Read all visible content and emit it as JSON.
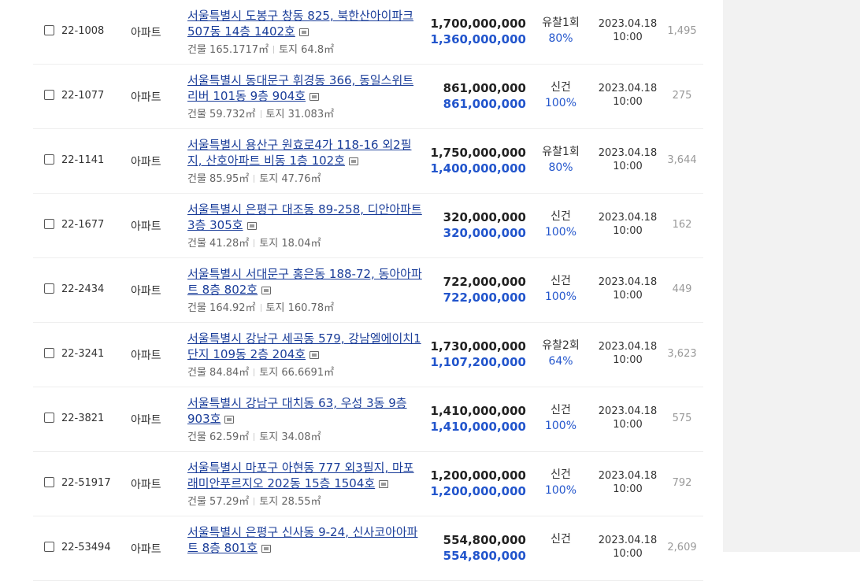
{
  "rows": [
    {
      "case": "22-1008",
      "kind": "아파트",
      "addr": "서울특별시 도봉구 창동 825, 북한산아이파크 507동 14층 1402호",
      "building": "건물 165.1717㎡",
      "land": "토지 64.8㎡",
      "appraised": "1,700,000,000",
      "minimum": "1,360,000,000",
      "status": "유찰1회",
      "percent": "80%",
      "date": "2023.04.18",
      "time": "10:00",
      "views": "1,495"
    },
    {
      "case": "22-1077",
      "kind": "아파트",
      "addr": "서울특별시 동대문구 휘경동 366, 동일스위트리버 101동 9층 904호",
      "building": "건물 59.732㎡",
      "land": "토지 31.083㎡",
      "appraised": "861,000,000",
      "minimum": "861,000,000",
      "status": "신건",
      "percent": "100%",
      "date": "2023.04.18",
      "time": "10:00",
      "views": "275"
    },
    {
      "case": "22-1141",
      "kind": "아파트",
      "addr": "서울특별시 용산구 원효로4가 118-16 외2필지, 산호아파트 비동 1층 102호",
      "building": "건물 85.95㎡",
      "land": "토지 47.76㎡",
      "appraised": "1,750,000,000",
      "minimum": "1,400,000,000",
      "status": "유찰1회",
      "percent": "80%",
      "date": "2023.04.18",
      "time": "10:00",
      "views": "3,644"
    },
    {
      "case": "22-1677",
      "kind": "아파트",
      "addr": "서울특별시 은평구 대조동 89-258, 디안아파트 3층 305호",
      "building": "건물 41.28㎡",
      "land": "토지 18.04㎡",
      "appraised": "320,000,000",
      "minimum": "320,000,000",
      "status": "신건",
      "percent": "100%",
      "date": "2023.04.18",
      "time": "10:00",
      "views": "162"
    },
    {
      "case": "22-2434",
      "kind": "아파트",
      "addr": "서울특별시 서대문구 홍은동 188-72, 동아아파트 8층 802호",
      "building": "건물 164.92㎡",
      "land": "토지 160.78㎡",
      "appraised": "722,000,000",
      "minimum": "722,000,000",
      "status": "신건",
      "percent": "100%",
      "date": "2023.04.18",
      "time": "10:00",
      "views": "449"
    },
    {
      "case": "22-3241",
      "kind": "아파트",
      "addr": "서울특별시 강남구 세곡동 579, 강남엘에이치1단지 109동 2층 204호",
      "building": "건물 84.84㎡",
      "land": "토지 66.6691㎡",
      "appraised": "1,730,000,000",
      "minimum": "1,107,200,000",
      "status": "유찰2회",
      "percent": "64%",
      "date": "2023.04.18",
      "time": "10:00",
      "views": "3,623"
    },
    {
      "case": "22-3821",
      "kind": "아파트",
      "addr": "서울특별시 강남구 대치동 63, 우성 3동 9층 903호",
      "building": "건물 62.59㎡",
      "land": "토지 34.08㎡",
      "appraised": "1,410,000,000",
      "minimum": "1,410,000,000",
      "status": "신건",
      "percent": "100%",
      "date": "2023.04.18",
      "time": "10:00",
      "views": "575"
    },
    {
      "case": "22-51917",
      "kind": "아파트",
      "addr": "서울특별시 마포구 아현동 777 외3필지, 마포래미안푸르지오 202동 15층 1504호",
      "building": "건물 57.29㎡",
      "land": "토지 28.55㎡",
      "appraised": "1,200,000,000",
      "minimum": "1,200,000,000",
      "status": "신건",
      "percent": "100%",
      "date": "2023.04.18",
      "time": "10:00",
      "views": "792"
    },
    {
      "case": "22-53494",
      "kind": "아파트",
      "addr": "서울특별시 은평구 신사동 9-24, 신사코아아파트 8층 801호",
      "building": "",
      "land": "",
      "appraised": "554,800,000",
      "minimum": "554,800,000",
      "status": "신건",
      "percent": "",
      "date": "2023.04.18",
      "time": "10:00",
      "views": "2,609"
    }
  ]
}
